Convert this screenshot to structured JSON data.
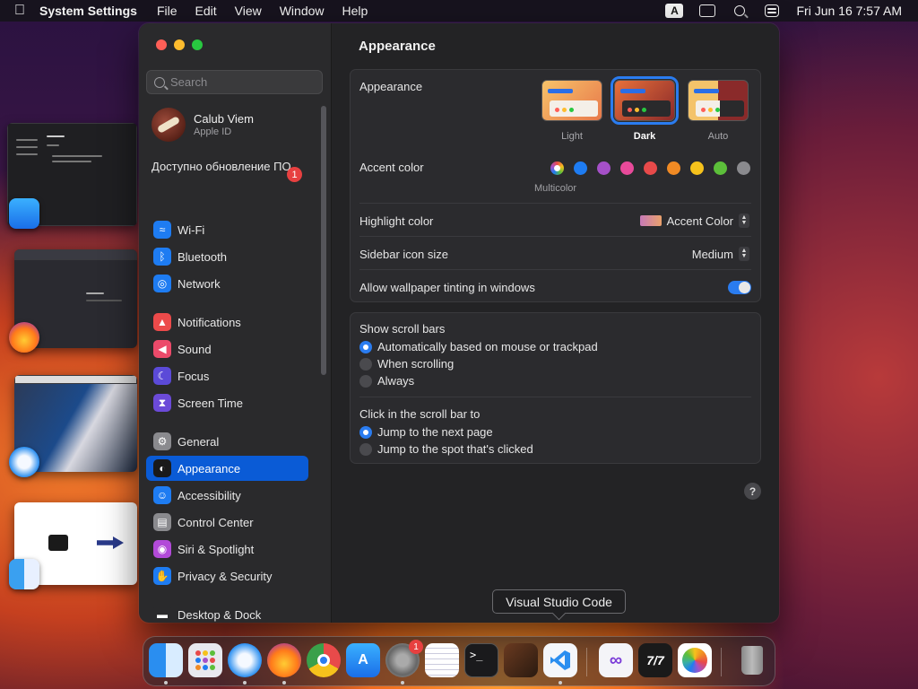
{
  "menubar": {
    "app_name": "System Settings",
    "menus": [
      "File",
      "Edit",
      "View",
      "Window",
      "Help"
    ],
    "input_source": "A",
    "clock": "Fri Jun 16  7:57 AM"
  },
  "sidebar": {
    "search_placeholder": "Search",
    "user_name": "Calub Viem",
    "user_sub": "Apple ID",
    "update_text": "Доступно обновление ПО",
    "update_badge": "1",
    "items": [
      {
        "label": "Wi-Fi",
        "icon": "wifi-icon",
        "color": "#1e7cf2"
      },
      {
        "label": "Bluetooth",
        "icon": "bluetooth-icon",
        "color": "#1e7cf2"
      },
      {
        "label": "Network",
        "icon": "globe-icon",
        "color": "#1e7cf2"
      },
      {
        "label": "Notifications",
        "icon": "bell-icon",
        "color": "#ec4a4a"
      },
      {
        "label": "Sound",
        "icon": "speaker-icon",
        "color": "#ec4a6a"
      },
      {
        "label": "Focus",
        "icon": "moon-icon",
        "color": "#5b4ad8"
      },
      {
        "label": "Screen Time",
        "icon": "hourglass-icon",
        "color": "#6b4ad8"
      },
      {
        "label": "General",
        "icon": "gear-icon",
        "color": "#8a8a8e"
      },
      {
        "label": "Appearance",
        "icon": "appearance-icon",
        "color": "#1a1a1a"
      },
      {
        "label": "Accessibility",
        "icon": "accessibility-icon",
        "color": "#1e7cf2"
      },
      {
        "label": "Control Center",
        "icon": "control-center-icon",
        "color": "#8a8a8e"
      },
      {
        "label": "Siri & Spotlight",
        "icon": "siri-icon",
        "color": "#b24ad8"
      },
      {
        "label": "Privacy & Security",
        "icon": "hand-icon",
        "color": "#1e7cf2"
      },
      {
        "label": "Desktop & Dock",
        "icon": "dock-icon",
        "color": "#2a2a2c"
      }
    ],
    "active": "Appearance"
  },
  "content": {
    "title": "Appearance",
    "appearance_label": "Appearance",
    "themes": [
      {
        "label": "Light",
        "selected": false
      },
      {
        "label": "Dark",
        "selected": true
      },
      {
        "label": "Auto",
        "selected": false
      }
    ],
    "accent_label": "Accent color",
    "accent_colors": [
      "multicolor",
      "#1e7cf2",
      "#a550c8",
      "#e84a9a",
      "#e84a4a",
      "#f08a24",
      "#f6c21c",
      "#5cbf3a",
      "#8a8a8e"
    ],
    "accent_selected_name": "Multicolor",
    "highlight_label": "Highlight color",
    "highlight_value": "Accent Color",
    "icon_size_label": "Sidebar icon size",
    "icon_size_value": "Medium",
    "tinting_label": "Allow wallpaper tinting in windows",
    "tinting_on": true,
    "scroll_bars_label": "Show scroll bars",
    "scroll_bar_options": [
      {
        "label": "Automatically based on mouse or trackpad",
        "selected": true
      },
      {
        "label": "When scrolling",
        "selected": false
      },
      {
        "label": "Always",
        "selected": false
      }
    ],
    "click_label": "Click in the scroll bar to",
    "click_options": [
      {
        "label": "Jump to the next page",
        "selected": true
      },
      {
        "label": "Jump to the spot that's clicked",
        "selected": false
      }
    ],
    "help": "?"
  },
  "tooltip": "Visual Studio Code",
  "dock": {
    "settings_badge": "1",
    "apps": [
      {
        "name": "finder-icon"
      },
      {
        "name": "launchpad-icon"
      },
      {
        "name": "safari-icon"
      },
      {
        "name": "firefox-icon"
      },
      {
        "name": "chrome-icon"
      },
      {
        "name": "app-store-icon"
      },
      {
        "name": "system-settings-icon"
      },
      {
        "name": "textedit-icon"
      },
      {
        "name": "terminal-icon"
      },
      {
        "name": "instruments-icon"
      },
      {
        "name": "vscode-icon"
      },
      {
        "name": "visual-studio-icon"
      },
      {
        "name": "tt-app-icon"
      },
      {
        "name": "photos-icon"
      },
      {
        "name": "trash-icon"
      }
    ]
  },
  "colors": {
    "accent": "#2a7cf0",
    "active_sidebar": "#0a5bd6"
  }
}
